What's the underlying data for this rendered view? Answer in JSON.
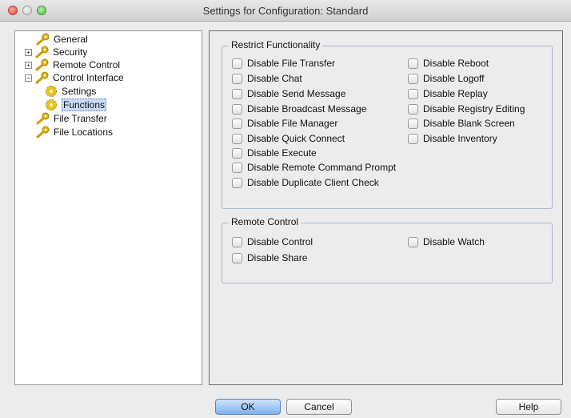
{
  "window": {
    "title": "Settings for Configuration: Standard"
  },
  "tree": {
    "items": [
      {
        "label": "General",
        "expander": "",
        "icon": "key-icon"
      },
      {
        "label": "Security",
        "expander": "+",
        "icon": "key-icon"
      },
      {
        "label": "Remote Control",
        "expander": "+",
        "icon": "key-icon"
      },
      {
        "label": "Control Interface",
        "expander": "−",
        "icon": "key-icon"
      },
      {
        "label": "Settings",
        "expander": "",
        "icon": "gear-icon"
      },
      {
        "label": "Functions",
        "expander": "",
        "icon": "gear-icon",
        "selected": true
      },
      {
        "label": "File Transfer",
        "expander": "",
        "icon": "key-icon"
      },
      {
        "label": "File Locations",
        "expander": "",
        "icon": "key-icon"
      }
    ]
  },
  "restrict": {
    "title": "Restrict Functionality",
    "left": [
      "Disable File Transfer",
      "Disable Chat",
      "Disable Send Message",
      "Disable Broadcast Message",
      "Disable File Manager",
      "Disable Quick Connect",
      "Disable Execute",
      "Disable Remote Command Prompt",
      "Disable Duplicate Client Check"
    ],
    "right": [
      "Disable Reboot",
      "Disable Logoff",
      "Disable Replay",
      "Disable Registry Editing",
      "Disable Blank Screen",
      "Disable Inventory"
    ]
  },
  "remote": {
    "title": "Remote Control",
    "left": [
      "Disable Control",
      "Disable Share"
    ],
    "right": [
      "Disable Watch"
    ]
  },
  "buttons": {
    "ok": "OK",
    "cancel": "Cancel",
    "help": "Help"
  },
  "colors": {
    "accent": "#7fb1ed",
    "selection": "#c7dcf7"
  }
}
